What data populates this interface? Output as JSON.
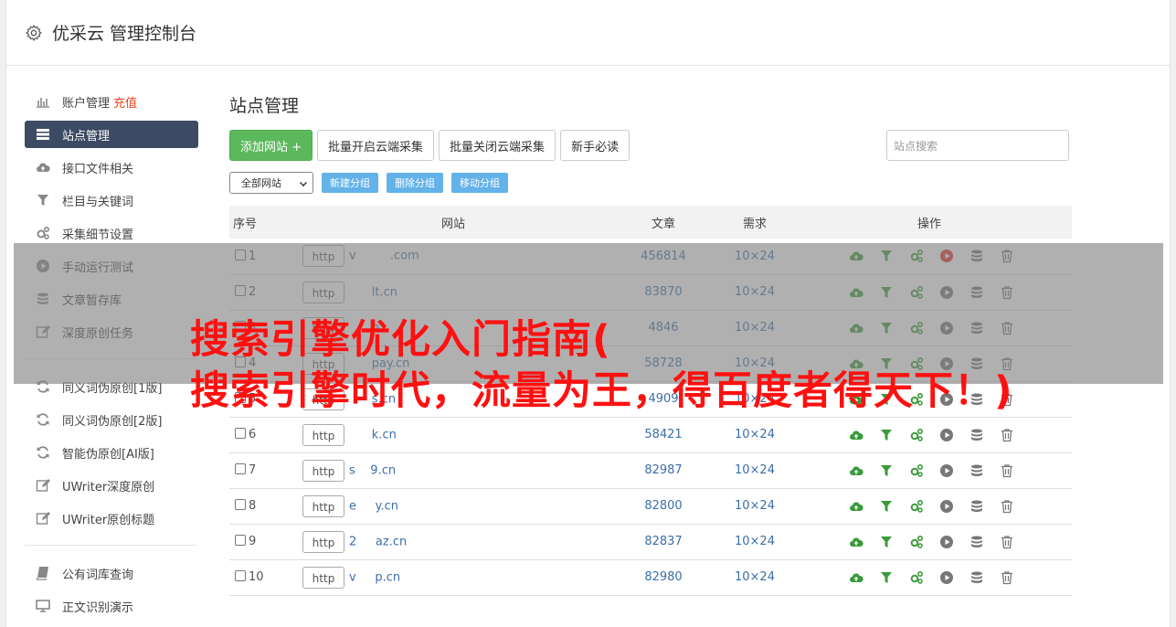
{
  "app": {
    "title": "优采云 管理控制台"
  },
  "sidebar": {
    "items": [
      {
        "label": "账户管理",
        "extra": "充值",
        "icon": "bar-chart-icon",
        "active": false
      },
      {
        "label": "站点管理",
        "icon": "server-list-icon",
        "active": true
      },
      {
        "label": "接口文件相关",
        "icon": "cloud-upload-icon",
        "active": false
      },
      {
        "label": "栏目与关键词",
        "icon": "filter-icon",
        "active": false
      },
      {
        "label": "采集细节设置",
        "icon": "gears-icon",
        "active": false
      },
      {
        "label": "手动运行测试",
        "icon": "play-circle-icon",
        "active": false
      },
      {
        "label": "文章暂存库",
        "icon": "database-icon",
        "active": false
      },
      {
        "label": "深度原创任务",
        "icon": "edit-icon",
        "active": false
      }
    ],
    "items2": [
      {
        "label": "同义词伪原创[1版]",
        "icon": "refresh-icon"
      },
      {
        "label": "同义词伪原创[2版]",
        "icon": "refresh-icon"
      },
      {
        "label": "智能伪原创[AI版]",
        "icon": "refresh-icon"
      },
      {
        "label": "UWriter深度原创",
        "icon": "edit-icon"
      },
      {
        "label": "UWriter原创标题",
        "icon": "edit-icon"
      }
    ],
    "items3": [
      {
        "label": "公有词库查询",
        "icon": "book-icon"
      },
      {
        "label": "正文识别演示",
        "icon": "monitor-icon"
      }
    ]
  },
  "main": {
    "title": "站点管理",
    "toolbar": {
      "add": "添加网站 +",
      "batch_open": "批量开启云端采集",
      "batch_close": "批量关闭云端采集",
      "guide": "新手必读",
      "search_placeholder": "站点搜索"
    },
    "group_select": "全部网站",
    "group_buttons": [
      "新建分组",
      "删除分组",
      "移动分组"
    ],
    "table": {
      "headers": [
        "序号",
        "网站",
        "文章",
        "需求",
        "操作"
      ],
      "protocol_label": "http",
      "rows": [
        {
          "no": "1",
          "domain": "v         .com",
          "articles": "456814",
          "need": "10×24",
          "running": true
        },
        {
          "no": "2",
          "domain": "      lt.cn",
          "articles": "83870",
          "need": "10×24",
          "running": false
        },
        {
          "no": "3",
          "domain": "      n",
          "articles": "4846",
          "need": "10×24",
          "running": false
        },
        {
          "no": "4",
          "domain": "      pay.cn",
          "articles": "58728",
          "need": "10×24",
          "running": false
        },
        {
          "no": "5",
          "domain": "      s.cn",
          "articles": "4909",
          "need": "10×24",
          "running": false
        },
        {
          "no": "6",
          "domain": "      k.cn",
          "articles": "58421",
          "need": "10×24",
          "running": false
        },
        {
          "no": "7",
          "domain": "s    9.cn",
          "articles": "82987",
          "need": "10×24",
          "running": false
        },
        {
          "no": "8",
          "domain": "e     y.cn",
          "articles": "82800",
          "need": "10×24",
          "running": false
        },
        {
          "no": "9",
          "domain": "2     az.cn",
          "articles": "82837",
          "need": "10×24",
          "running": false
        },
        {
          "no": "10",
          "domain": "v     p.cn",
          "articles": "82980",
          "need": "10×24",
          "running": false
        }
      ]
    }
  },
  "overlay": {
    "line1": "搜索引擎优化入门指南(",
    "line2": "搜索引擎时代，流量为王，得百度者得天下！)"
  },
  "colors": {
    "accent_green": "#5cb85c",
    "sidebar_active": "#3d4a63",
    "link_blue": "#3b6ea8",
    "overlay_text": "#ff1010"
  }
}
